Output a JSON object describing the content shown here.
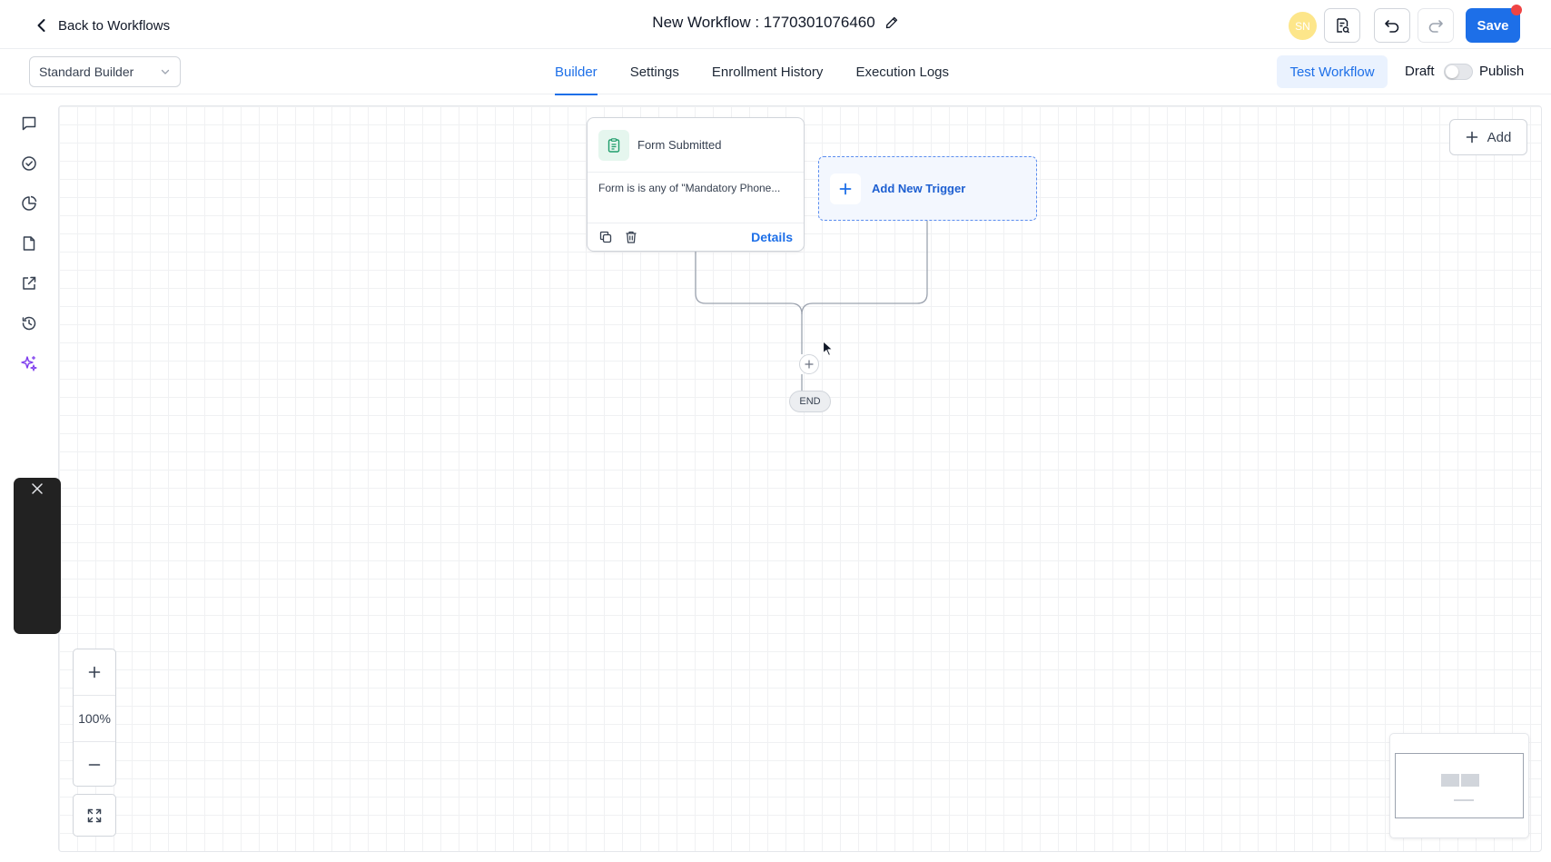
{
  "header": {
    "back_label": "Back to Workflows",
    "workflow_title": "New Workflow : 1770301076460",
    "avatar_initials": "SN",
    "save_label": "Save"
  },
  "subheader": {
    "builder_mode": "Standard Builder",
    "tabs": [
      {
        "label": "Builder",
        "active": true
      },
      {
        "label": "Settings",
        "active": false
      },
      {
        "label": "Enrollment History",
        "active": false
      },
      {
        "label": "Execution Logs",
        "active": false
      }
    ],
    "test_workflow_label": "Test Workflow",
    "draft_label": "Draft",
    "publish_label": "Publish",
    "published": false
  },
  "sidebar": {
    "icons": [
      "chat-icon",
      "check-circle-icon",
      "pie-chart-icon",
      "document-icon",
      "external-link-icon",
      "history-icon",
      "sparkles-icon"
    ]
  },
  "canvas": {
    "add_label": "Add",
    "trigger": {
      "title": "Form Submitted",
      "condition": "Form is is any of \"Mandatory Phone...",
      "details_label": "Details"
    },
    "add_trigger_label": "Add New Trigger",
    "end_label": "END"
  },
  "zoom": {
    "level": "100%"
  },
  "colors": {
    "accent": "#1d6fe8",
    "trigger_icon_bg": "#e5f6ee",
    "trigger_icon": "#1f9d6b",
    "ai_icon": "#7c3aed",
    "notification_dot": "#ef4444"
  }
}
